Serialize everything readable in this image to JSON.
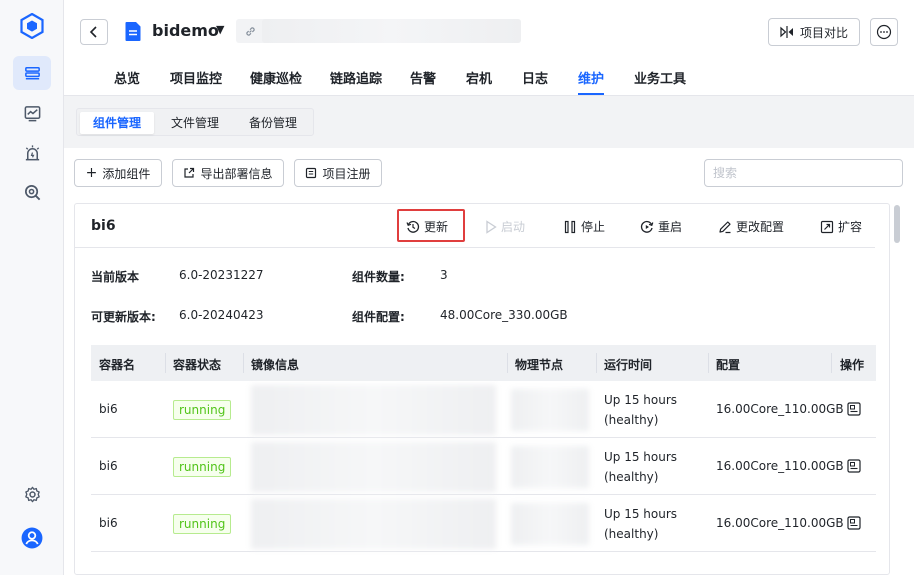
{
  "header": {
    "project_name": "bidemo",
    "compare_label": "项目对比"
  },
  "nav": {
    "tabs": [
      "总览",
      "项目监控",
      "健康巡检",
      "链路追踪",
      "告警",
      "宕机",
      "日志",
      "维护",
      "业务工具"
    ],
    "active": "维护"
  },
  "subtabs": {
    "items": [
      "组件管理",
      "文件管理",
      "备份管理"
    ],
    "active": "组件管理"
  },
  "toolbar": {
    "add_label": "添加组件",
    "export_label": "导出部署信息",
    "register_label": "项目注册",
    "search_placeholder": "搜索"
  },
  "component": {
    "name": "bi6",
    "actions": {
      "update": "更新",
      "start": "启动",
      "stop": "停止",
      "restart": "重启",
      "change_config": "更改配置",
      "scale": "扩容"
    },
    "info": {
      "current_version_label": "当前版本",
      "current_version": "6.0-20231227",
      "count_label": "组件数量:",
      "count": "3",
      "update_version_label": "可更新版本:",
      "update_version": "6.0-20240423",
      "config_label": "组件配置:",
      "config": "48.00Core_330.00GB"
    }
  },
  "table": {
    "headers": [
      "容器名",
      "容器状态",
      "镜像信息",
      "物理节点",
      "运行时间",
      "配置",
      "操作"
    ],
    "rows": [
      {
        "name": "bi6",
        "status": "running",
        "uptime1": "Up 15 hours",
        "uptime2": "(healthy)",
        "config": "16.00Core_110.00GB"
      },
      {
        "name": "bi6",
        "status": "running",
        "uptime1": "Up 15 hours",
        "uptime2": "(healthy)",
        "config": "16.00Core_110.00GB"
      },
      {
        "name": "bi6",
        "status": "running",
        "uptime1": "Up 15 hours",
        "uptime2": "(healthy)",
        "config": "16.00Core_110.00GB"
      }
    ]
  },
  "colors": {
    "accent": "#1a66ff",
    "running": "#52c41a",
    "highlight_box": "#e03e3e"
  }
}
